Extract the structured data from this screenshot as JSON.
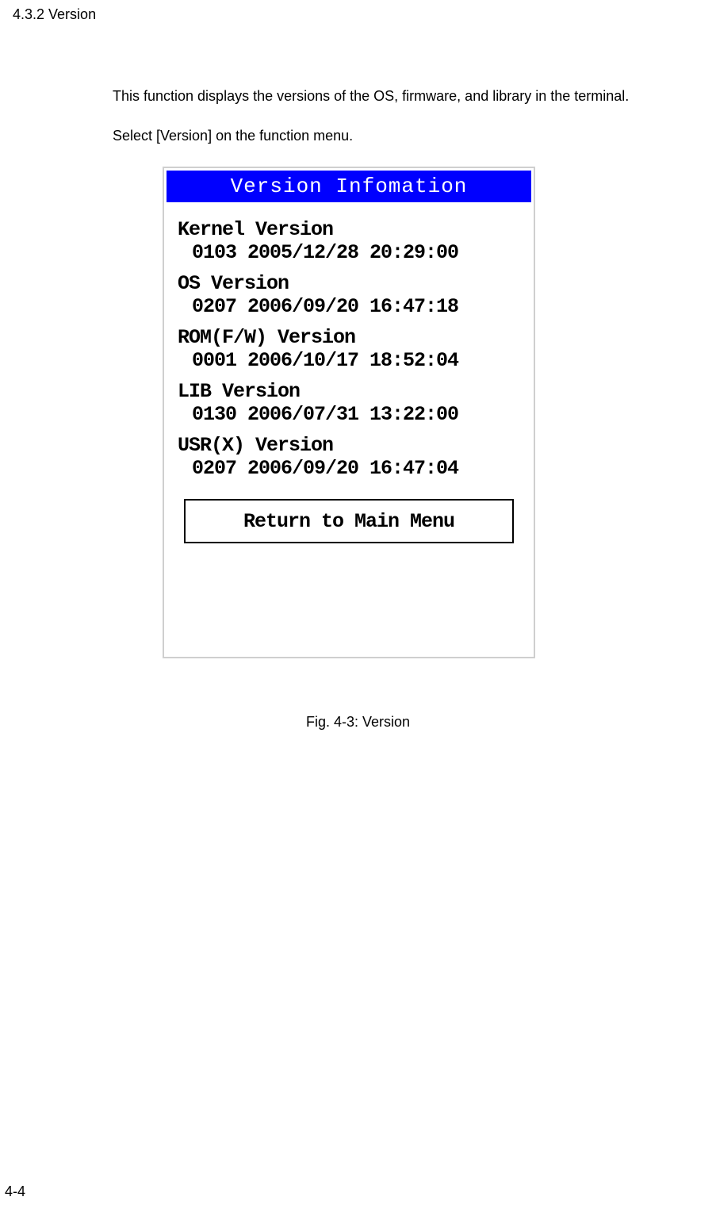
{
  "section_heading": "4.3.2 Version",
  "paragraph1": "This function displays the versions of the OS, firmware, and library in the terminal.",
  "paragraph2": "Select [Version] on the function menu.",
  "screen": {
    "title": "Version Infomation",
    "items": [
      {
        "label": "Kernel Version",
        "value": "0103 2005/12/28 20:29:00"
      },
      {
        "label": "OS Version",
        "value": "0207 2006/09/20 16:47:18"
      },
      {
        "label": "ROM(F/W) Version",
        "value": "0001 2006/10/17 18:52:04"
      },
      {
        "label": "LIB Version",
        "value": "0130 2006/07/31 13:22:00"
      },
      {
        "label": "USR(X) Version",
        "value": "0207 2006/09/20 16:47:04"
      }
    ],
    "return_btn": "Return to Main Menu"
  },
  "caption": "Fig. 4-3: Version",
  "page_number": "4-4"
}
